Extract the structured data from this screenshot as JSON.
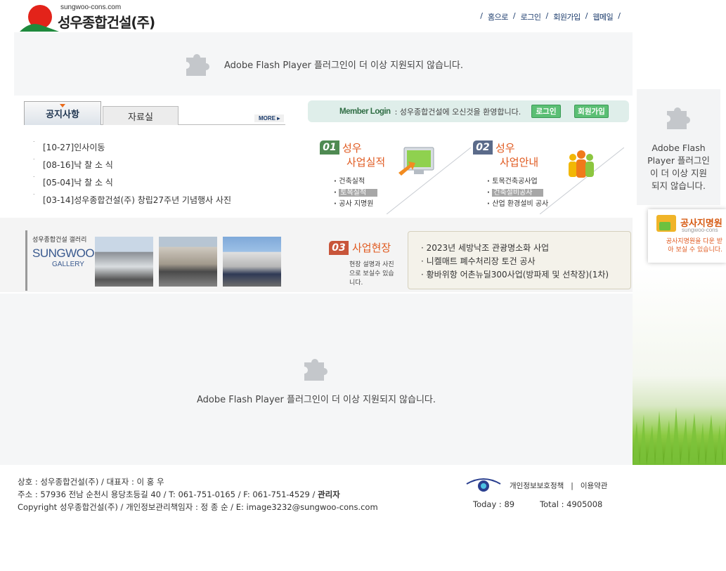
{
  "header": {
    "domain": "sungwoo-cons.com",
    "company": "성우종합건설(주)",
    "nav": [
      "홈으로",
      "로그인",
      "회원가입",
      "웹메일"
    ]
  },
  "flash": {
    "message_long": "Adobe Flash Player 플러그인이 더 이상 지원되지 않습니다.",
    "message_side": "Adobe Flash Player 플러그인이 더 이상 지원되지 않습니다."
  },
  "notice": {
    "tabs": [
      "공지사항",
      "자료실"
    ],
    "more": "MORE",
    "items": [
      "[10-27]인사이동",
      "[08-16]낙 찰 소 식",
      "[05-04]낙 찰 소 식",
      "[03-14]성우종합건설(주) 창립27주년 기념행사 사진"
    ]
  },
  "login": {
    "label": "Member Login",
    "welcome": ": 성우종합건설에 오신것을 환영합니다.",
    "login_button": "로그인",
    "join_button": "회원가입"
  },
  "business": [
    {
      "num": "01",
      "title1": "성우",
      "title2": "사업실적",
      "items": [
        "건축실적",
        "토목실적",
        "공사 지명원"
      ],
      "highlight": 1
    },
    {
      "num": "02",
      "title1": "성우",
      "title2": "사업안내",
      "items": [
        "토목건축공사업",
        "건축설비공사",
        "산업 환경설비 공사"
      ],
      "highlight": 1
    }
  ],
  "gallery": {
    "kr": "성우종합건설 갤러리",
    "title": "SUNGWOO",
    "sub": "GALLERY"
  },
  "site": {
    "num": "03",
    "title": "사업현장",
    "desc": "현장 설명과 사진으로 보실수 있습니다.",
    "items": [
      "· 2023년 세방낙조 관광명소화 사업",
      "· 니켈매트 폐수처리장 토건 공사",
      "· 황바위항 어촌뉴딜300사업(방파제 및 선착장)(1차)"
    ]
  },
  "side_banner": {
    "title": "공사지명원",
    "domain": "sungwoo-cons",
    "desc": "공사지명원을 다운 받아 보실 수 있습니다."
  },
  "footer": {
    "line1": "상호 : 성우종합건설(주) / 대표자 : 이 홍 우",
    "line2": "주소 : 57936 전남 순천시 용당초등길 40 / T: 061-751-0165 / F: 061-751-4529 / ",
    "admin": "관리자",
    "line3": "Copyright 성우종합건설(주) / 개인정보관리책임자 : 정 종 순 / E: image3232@sungwoo-cons.com",
    "privacy": "개인정보보호정책",
    "terms": "이용약관",
    "today": "Today : 89",
    "total": "Total : 4905008"
  },
  "colors": {
    "accent_orange": "#e05a20",
    "login_green": "#5bbf74",
    "flash_bg": "#f5f6f7"
  }
}
